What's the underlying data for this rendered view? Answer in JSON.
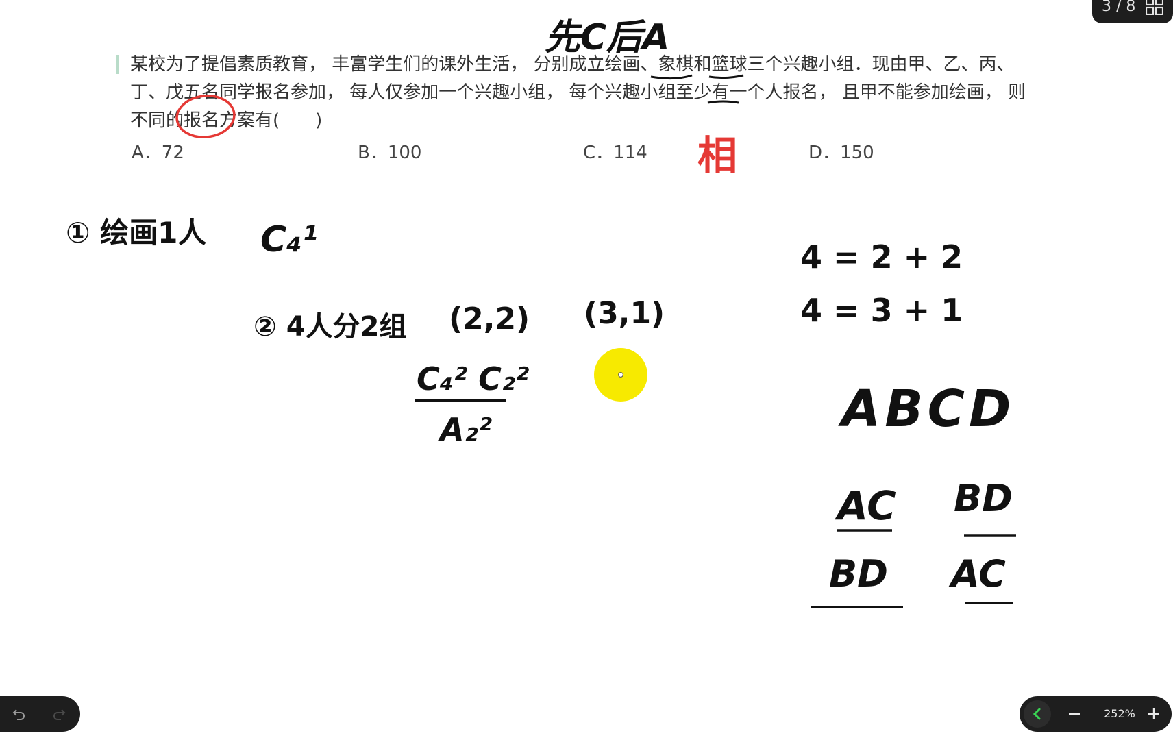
{
  "page_indicator": {
    "text": "3 / 8"
  },
  "heading": "先C后A",
  "question": {
    "text": "某校为了提倡素质教育， 丰富学生们的课外生活， 分别成立绘画、象棋和篮球三个兴趣小组．现由甲、乙、丙、丁、戊五名同学报名参加， 每人仅参加一个兴趣小组， 每个兴趣小组至少有一个人报名， 且甲不能参加绘画， 则不同的报名方案有(　　)",
    "options": [
      "A．72",
      "B．100",
      "C．114",
      "D．150"
    ]
  },
  "annotations": {
    "red_mark": "相",
    "step1": "① 绘画1人",
    "step1_result": "C₄¹",
    "step2": "② 4人分2组",
    "case_a": "(2,2)",
    "case_b": "(3,1)",
    "fraction_top": "C₄² C₂²",
    "fraction_bottom": "A₂²",
    "eq1": "4 = 2 + 2",
    "eq2": "4 = 3 + 1",
    "letters": "ABCD",
    "pair_ac_1": "AC",
    "pair_bd_1": "BD",
    "pair_bd_2": "BD",
    "pair_ac_2": "AC"
  },
  "zoom": {
    "value": "252%"
  },
  "colors": {
    "ink": "#111111",
    "red_ink": "#e53935",
    "pointer": "#f7ea00",
    "toolbar": "#1e1e1e",
    "accent_green": "#39d353"
  },
  "icons": [
    "undo-icon",
    "redo-icon",
    "grid-icon",
    "chevron-left-icon",
    "minus-icon",
    "plus-icon"
  ]
}
